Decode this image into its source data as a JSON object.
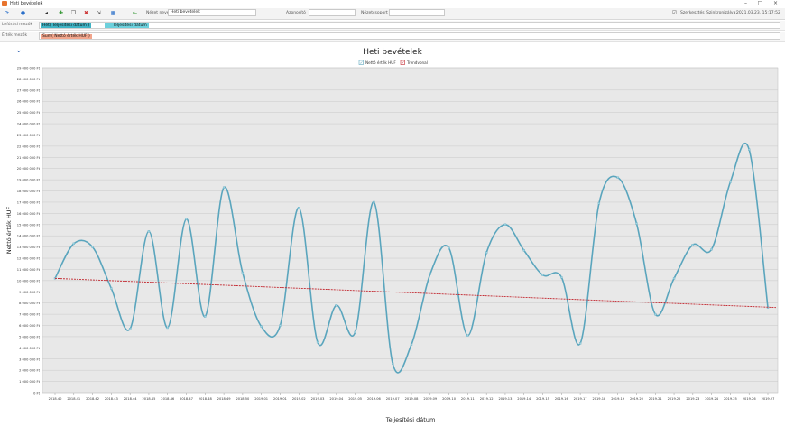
{
  "window": {
    "title": "Heti bevételek",
    "controls": [
      "–",
      "□",
      "×"
    ]
  },
  "toolbar": {
    "view_name_label": "Nézet neve",
    "view_name_value": "Heti bevételek",
    "id_label": "Azonosító",
    "group_label": "Nézetcsoport",
    "filter_label": "Szerkesztés",
    "sync_label": "Szinkronizálva:",
    "sync_time": "2021.03.23. 15:17:52"
  },
  "filters": {
    "rows_label": "Lefúrási mezők",
    "values_label": "Érték mezők",
    "row_chips": [
      "Hét( Teljesítési dátum )",
      "Teljesítési dátum"
    ],
    "value_chips": [
      "Sum( Nettó érték HUF )"
    ]
  },
  "chart_data": {
    "type": "line",
    "title": "Heti bevételek",
    "xlabel": "Teljesítési dátum",
    "ylabel": "Nettó érték HUF",
    "ylim": [
      0,
      29000000
    ],
    "ytick_step": 1000000,
    "ytick_suffix": " Ft",
    "legend_position": "top-center",
    "grid": true,
    "categories": [
      "2018.40",
      "2018.41",
      "2018.42",
      "2018.43",
      "2018.44",
      "2018.45",
      "2018.46",
      "2018.47",
      "2018.48",
      "2018.49",
      "2018.50",
      "2019.01",
      "2019.01",
      "2019.02",
      "2019.03",
      "2019.04",
      "2019.05",
      "2019.06",
      "2019.07",
      "2019.08",
      "2019.09",
      "2019.10",
      "2019.11",
      "2019.12",
      "2019.13",
      "2019.14",
      "2019.15",
      "2019.16",
      "2019.17",
      "2019.18",
      "2019.19",
      "2019.20",
      "2019.21",
      "2019.22",
      "2019.23",
      "2019.24",
      "2019.25",
      "2019.26",
      "2019.27"
    ],
    "series": [
      {
        "name": "Nettó érték HUF",
        "color": "#5aa5bd",
        "values": [
          10200000,
          13300000,
          13000000,
          9300000,
          5700000,
          14400000,
          5800000,
          15500000,
          6800000,
          18300000,
          10700000,
          5900000,
          6000000,
          16500000,
          4500000,
          7800000,
          5400000,
          17000000,
          2600000,
          4300000,
          10600000,
          12900000,
          5100000,
          12500000,
          15000000,
          12700000,
          10500000,
          10300000,
          4400000,
          16900000,
          19200000,
          15100000,
          7000000,
          10200000,
          13200000,
          12800000,
          18800000,
          21700000,
          7600000
        ]
      },
      {
        "name": "Trendvonal",
        "color": "#c2262e",
        "values": [
          10200000,
          7600000
        ]
      }
    ]
  }
}
